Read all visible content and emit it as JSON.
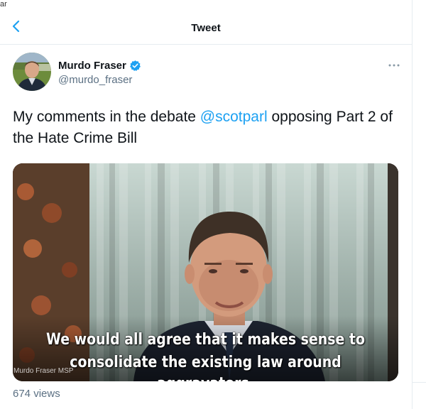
{
  "window": {
    "edge_label": "ar"
  },
  "header": {
    "title": "Tweet",
    "back_icon": "chevron-left-icon"
  },
  "author": {
    "name": "Murdo Fraser",
    "handle": "@murdo_fraser",
    "verified": true,
    "more_icon": "more-horizontal-icon"
  },
  "tweet": {
    "text_before": "My comments in the debate ",
    "mention": "@scotparl",
    "text_after": " opposing Part 2 of the Hate Crime Bill"
  },
  "media": {
    "subtitle_line1": "We would all agree that it makes sense to",
    "subtitle_line2": "consolidate the existing law around aggravators.",
    "caption": "Murdo Fraser MSP"
  },
  "stats": {
    "views": "674 views"
  },
  "colors": {
    "accent": "#1da1f2",
    "text": "#0f1419",
    "secondary": "#5b7083",
    "border": "#e6ecf0"
  }
}
